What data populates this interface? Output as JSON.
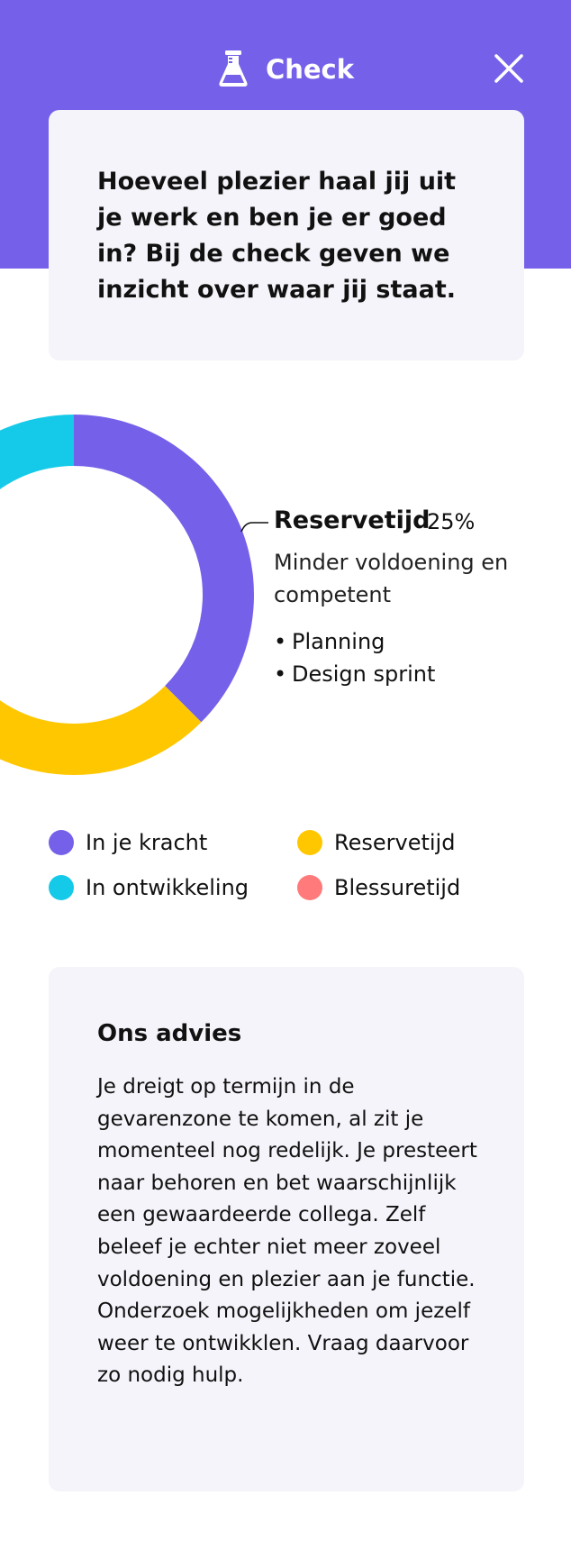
{
  "header": {
    "title": "Check",
    "flask_icon": "flask-icon",
    "close_icon": "close-icon",
    "background_color": "#7561E9"
  },
  "intro": {
    "text": "Hoeveel plezier haal jij uit je werk en ben je er goed in? Bij de check geven we inzicht over waar jij staat."
  },
  "chart_data": {
    "type": "pie",
    "categories": [
      "In je kracht",
      "Reservetijd",
      "Blessuretijd",
      "In ontwikkeling"
    ],
    "values": [
      37.5,
      25,
      12.5,
      25
    ],
    "colors": [
      "#7561E9",
      "#FFC700",
      "#FF7A7A",
      "#15CAE8"
    ],
    "highlighted": "Reservetijd"
  },
  "callout": {
    "label": "Reservetijd",
    "percent": "25%",
    "description": "Minder voldoening en competent",
    "items": [
      "Planning",
      "Design sprint"
    ]
  },
  "legend": [
    {
      "label": "In je kracht",
      "color": "#7561E9"
    },
    {
      "label": "Reservetijd",
      "color": "#FFC700"
    },
    {
      "label": "In ontwikkeling",
      "color": "#15CAE8"
    },
    {
      "label": "Blessuretijd",
      "color": "#FF7A7A"
    }
  ],
  "advice": {
    "title": "Ons advies",
    "body": "Je dreigt op termijn in de gevarenzone te komen, al zit je momenteel nog redelijk. Je presteert naar behoren en bet waarschijnlijk een gewaardeerde collega. Zelf beleef je echter niet meer zoveel voldoening en plezier aan je functie. Onderzoek mogelijkheden om jezelf weer te ontwikklen. Vraag daarvoor zo nodig hulp."
  }
}
